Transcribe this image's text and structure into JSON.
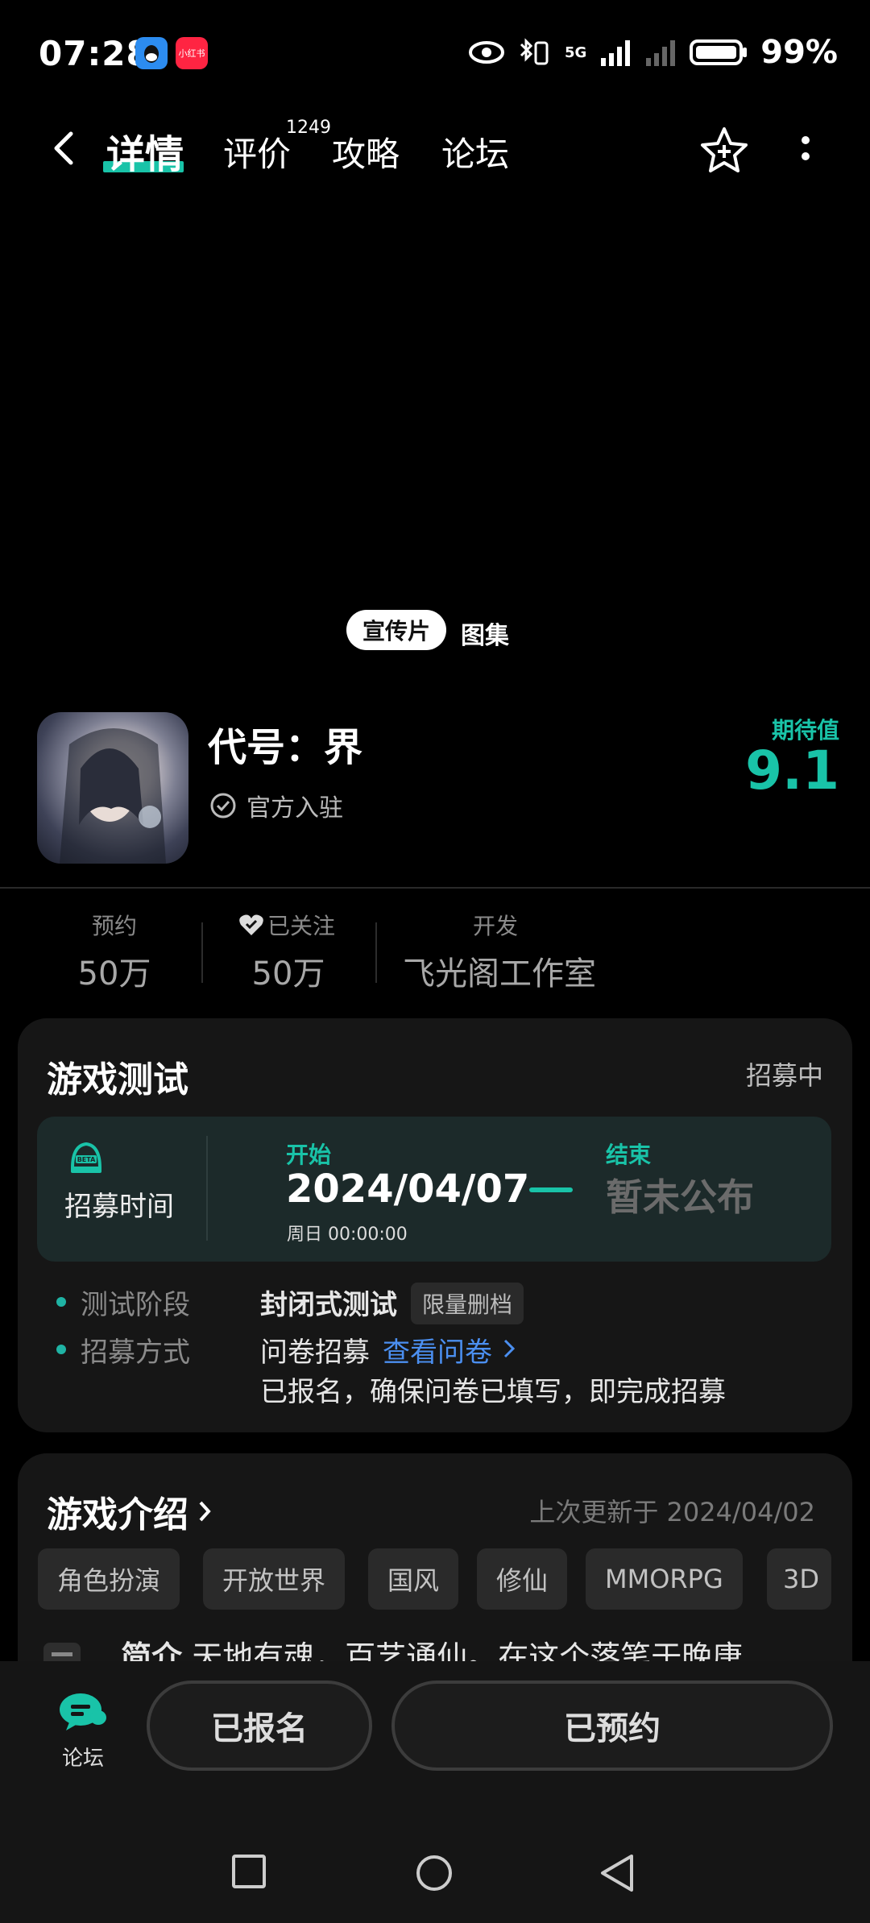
{
  "status_bar": {
    "time": "07:28",
    "app_badge_2": "小红书",
    "network": "5G",
    "battery": "99%"
  },
  "nav": {
    "tabs": [
      "详情",
      "评价",
      "攻略",
      "论坛"
    ],
    "review_count": "1249"
  },
  "media": {
    "tabs": [
      "宣传片",
      "图集"
    ],
    "active": "宣传片"
  },
  "game": {
    "title": "代号：界",
    "official_label": "官方入驻",
    "anticipation_label": "期待值",
    "anticipation_value": "9.1"
  },
  "stats": {
    "reservations_label": "预约",
    "reservations_value": "50万",
    "followed_label": "已关注",
    "followed_value": "50万",
    "developer_label": "开发",
    "developer_value": "飞光阁工作室"
  },
  "test_card": {
    "title": "游戏测试",
    "status": "招募中",
    "recruit_label": "招募时间",
    "start_label": "开始",
    "start_date": "2024/04/07",
    "start_time": "周日  00:00:00",
    "end_label": "结束",
    "end_value": "暂未公布",
    "phase_label": "测试阶段",
    "phase_value": "封闭式测试",
    "phase_chip": "限量删档",
    "method_label": "招募方式",
    "method_value": "问卷招募",
    "method_link": "查看问卷",
    "method_note": "已报名，确保问卷已填写，即完成招募"
  },
  "intro_card": {
    "title": "游戏介绍",
    "updated": "上次更新于 2024/04/02",
    "tags": [
      "角色扮演",
      "开放世界",
      "国风",
      "修仙",
      "MMORPG",
      "3D"
    ],
    "intro_prefix": "简介",
    "intro_text": "天地有魂，百艺通仙。在这个落笔于晚唐"
  },
  "bottom": {
    "forum_label": "论坛",
    "signed_up": "已报名",
    "reserved": "已预约"
  },
  "colors": {
    "accent": "#19c3a8",
    "link": "#4b8ff0",
    "card_bg": "#161616"
  }
}
